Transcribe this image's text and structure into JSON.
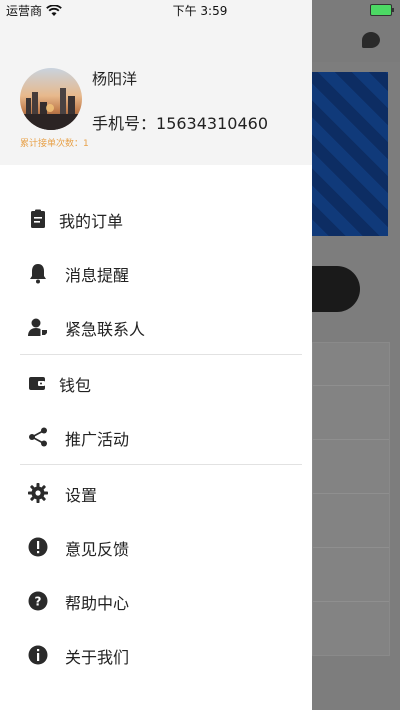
{
  "status_bar": {
    "carrier": "运营商",
    "time": "下午 3:59"
  },
  "profile": {
    "name": "杨阳洋",
    "phone_label": "手机号：",
    "phone": "15634310460",
    "order_count": "累计接单次数：1"
  },
  "menu": [
    {
      "label": "我的订单",
      "icon": "clipboard-icon"
    },
    {
      "label": "消息提醒",
      "icon": "bell-icon"
    },
    {
      "label": "紧急联系人",
      "icon": "contact-person-icon"
    },
    {
      "label": "钱包",
      "icon": "wallet-icon"
    },
    {
      "label": "推广活动",
      "icon": "share-icon"
    },
    {
      "label": "设置",
      "icon": "gear-icon"
    },
    {
      "label": "意见反馈",
      "icon": "feedback-icon"
    },
    {
      "label": "帮助中心",
      "icon": "help-icon"
    },
    {
      "label": "关于我们",
      "icon": "info-icon"
    }
  ],
  "colors": {
    "accent": "#e8a24a",
    "drawer": "#ffffff",
    "header": "#f4f4f4",
    "overlay": "#7d7d7d"
  }
}
